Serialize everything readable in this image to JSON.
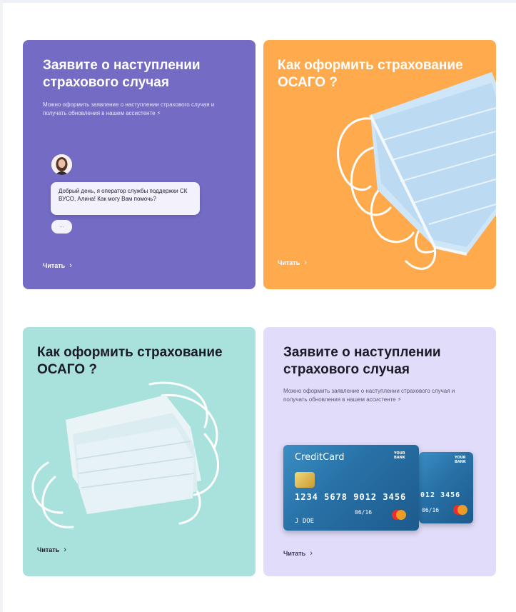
{
  "cards": [
    {
      "title": "Заявите о наступлении страхового случая",
      "description": "Можно оформить заявление о наступлении страхового случая и получать обновления в нашем ассистенте ⚡",
      "chat": {
        "message": "Добрый день, я оператор службы поддержки СК ВУСО, Алина! Как могу Вам помочь?",
        "typing": "..."
      },
      "link": "Читать"
    },
    {
      "title": "Как оформить страхование ОСАГО ?",
      "link": "Читать"
    },
    {
      "title": "Как оформить страхование ОСАГО ?",
      "link": "Читать"
    },
    {
      "title": "Заявите о наступлении страхового случая",
      "description": "Можно оформить заявление о наступлении страхового случая и получать обновления в нашем ассистенте ⚡",
      "credit_card": {
        "brand": "CreditCard",
        "bank_line1": "YOUR",
        "bank_line2": "BANK",
        "number": "1234 5678 9012 3456",
        "back_number": "012 3456",
        "expiry": "06/16",
        "holder": "J DOE"
      },
      "link": "Читать"
    }
  ],
  "colors": {
    "card1_bg": "#746cc4",
    "card2_bg": "#ffaa4c",
    "card3_bg": "#a9e1dc",
    "card4_bg": "#e1dcf9"
  },
  "icons": {
    "link_chevron": "chevron-right-icon"
  }
}
